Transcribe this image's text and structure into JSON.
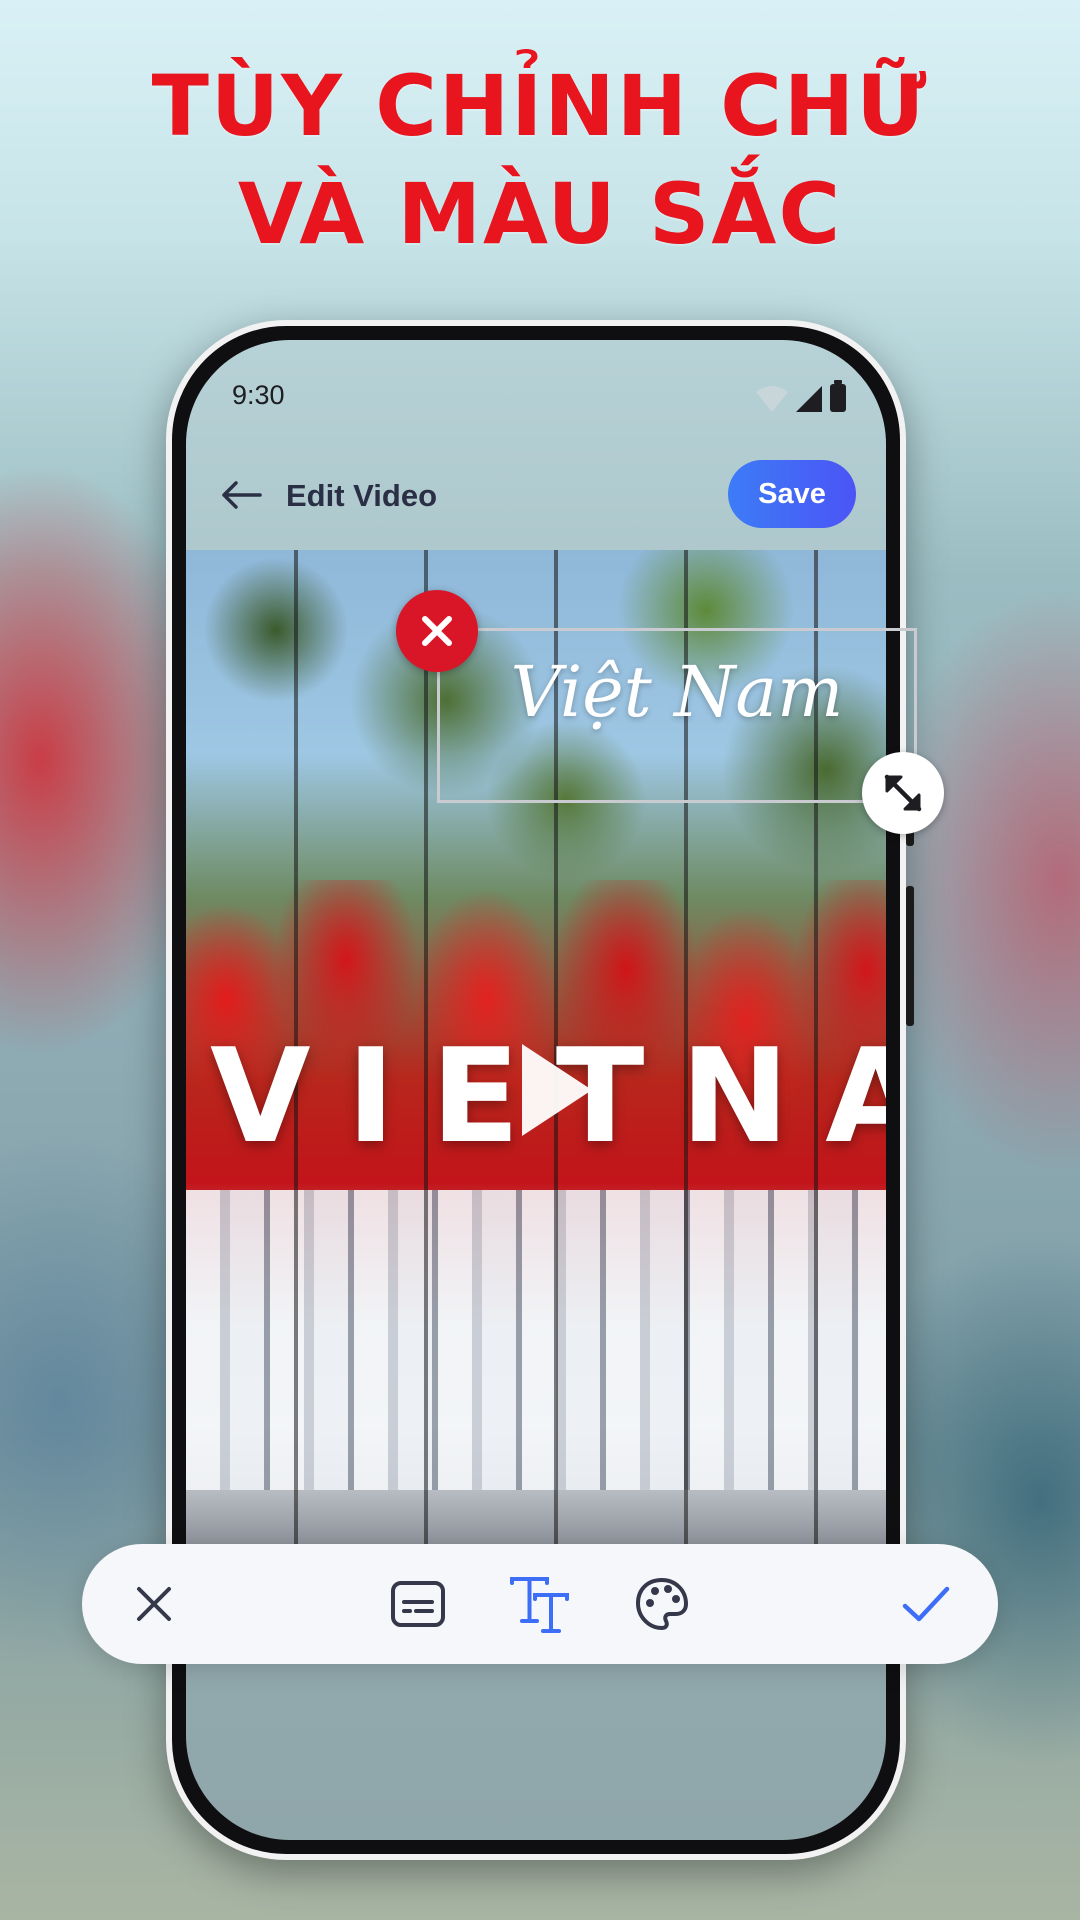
{
  "headline": {
    "line1": "TÙY CHỈNH CHỮ",
    "line2": "VÀ MÀU SẮC"
  },
  "status_bar": {
    "time": "9:30"
  },
  "app_bar": {
    "title": "Edit Video",
    "save_label": "Save"
  },
  "video": {
    "overlay_title": "VIETNAM"
  },
  "text_sticker": {
    "text": "Việt Nam"
  },
  "toolbar": {
    "icons": [
      "close-icon",
      "subtitle-icon",
      "text-style-icon",
      "palette-icon",
      "check-icon"
    ],
    "active_tool": "text-style-icon"
  },
  "colors": {
    "headline": "#e8141e",
    "accent": "#3d6ef7",
    "delete": "#d91628"
  }
}
